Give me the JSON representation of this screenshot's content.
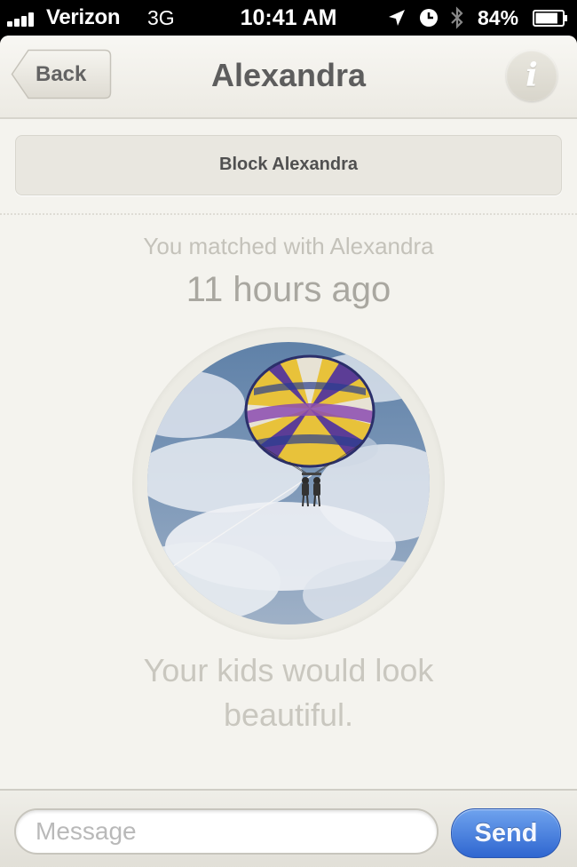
{
  "status_bar": {
    "carrier": "Verizon",
    "network": "3G",
    "time": "10:41 AM",
    "battery_percent": "84%",
    "signal_bars": 4,
    "battery_level": 0.84,
    "icons": [
      "signal-icon",
      "location-icon",
      "alarm-icon",
      "bluetooth-icon",
      "battery-icon"
    ]
  },
  "nav": {
    "back_label": "Back",
    "title": "Alexandra",
    "info_glyph": "i"
  },
  "block_button_label": "Block Alexandra",
  "match": {
    "line": "You matched with Alexandra",
    "time": "11 hours ago"
  },
  "photo": {
    "subject": "parasail-image"
  },
  "tagline": "Your kids would look beautiful.",
  "compose": {
    "placeholder": "Message",
    "value": "",
    "send_label": "Send"
  },
  "colors": {
    "background": "#f4f3ee",
    "send_accent": "#3a73d9",
    "muted_text": "#c4c2ba"
  }
}
